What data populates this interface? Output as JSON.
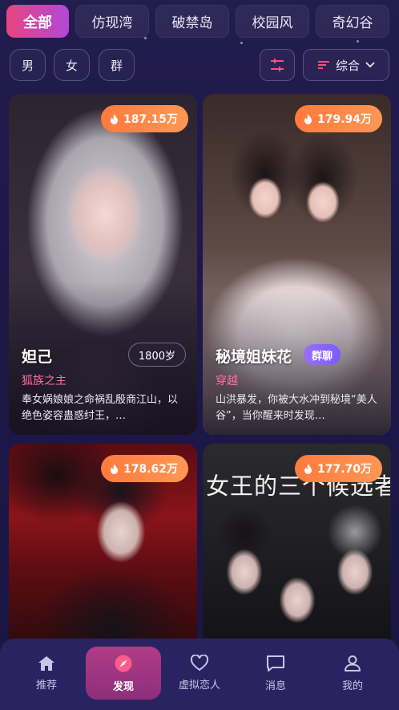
{
  "tabs": [
    "全部",
    "仿现湾",
    "破禁岛",
    "校园风",
    "奇幻谷"
  ],
  "filters": [
    "男",
    "女",
    "群"
  ],
  "sort": {
    "label": "综合"
  },
  "cards": [
    {
      "heat": "187.15万",
      "name": "妲己",
      "age": "1800岁",
      "tag": "狐族之主",
      "desc": "奉女娲娘娘之命祸乱殷商江山，以绝色姿容蛊惑纣王，…"
    },
    {
      "heat": "179.94万",
      "name": "秘境姐妹花",
      "group": "群聊",
      "tag": "穿越",
      "desc": "山洪暴发，你被大水冲到秘境“美人谷”，当你醒来时发现…"
    },
    {
      "heat": "178.62万"
    },
    {
      "heat": "177.70万",
      "poster_title": "女王的三个候选者"
    }
  ],
  "nav": [
    "推荐",
    "发现",
    "虚拟恋人",
    "消息",
    "我的"
  ],
  "colors": {
    "accent_start": "#e6457f",
    "accent_end": "#b248d8",
    "heat_badge": "#ff8a47",
    "tag_pink": "#ff6fa4",
    "nav_bg": "#2a2362"
  }
}
